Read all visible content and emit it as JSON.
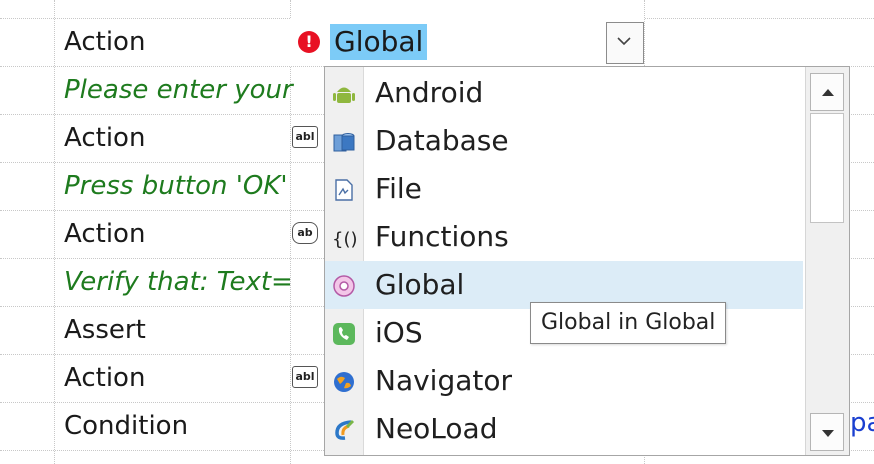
{
  "rows": [
    {
      "label": "Action",
      "style": "normal",
      "icon": ""
    },
    {
      "label": "Please enter your",
      "style": "comment",
      "icon": ""
    },
    {
      "label": "Action",
      "style": "normal",
      "icon": "abl"
    },
    {
      "label": "Press button 'OK'",
      "style": "comment",
      "icon": ""
    },
    {
      "label": "Action",
      "style": "normal",
      "icon": "ab"
    },
    {
      "label": "Verify that: Text=",
      "style": "comment",
      "icon": ""
    },
    {
      "label": "Assert",
      "style": "normal",
      "icon": ""
    },
    {
      "label": "Action",
      "style": "normal",
      "icon": "abl"
    },
    {
      "label": "Condition",
      "style": "normal",
      "icon": ""
    }
  ],
  "combo": {
    "value": "Global",
    "error_icon": "error-icon",
    "arrow_icon": "chevron-down-icon"
  },
  "dropdown": {
    "items": [
      {
        "label": "Android",
        "icon": "android-icon"
      },
      {
        "label": "Database",
        "icon": "database-icon"
      },
      {
        "label": "File",
        "icon": "file-icon"
      },
      {
        "label": "Functions",
        "icon": "functions-icon"
      },
      {
        "label": "Global",
        "icon": "global-icon",
        "highlighted": true
      },
      {
        "label": "iOS",
        "icon": "ios-icon"
      },
      {
        "label": "Navigator",
        "icon": "navigator-icon"
      },
      {
        "label": "NeoLoad",
        "icon": "neoload-icon"
      }
    ],
    "tooltip": "Global in Global"
  },
  "right_fragment": "pa",
  "colors": {
    "selection": "#7ccbf7",
    "highlight": "#dcecf7",
    "comment": "#1e7b1e",
    "error": "#e81123"
  }
}
